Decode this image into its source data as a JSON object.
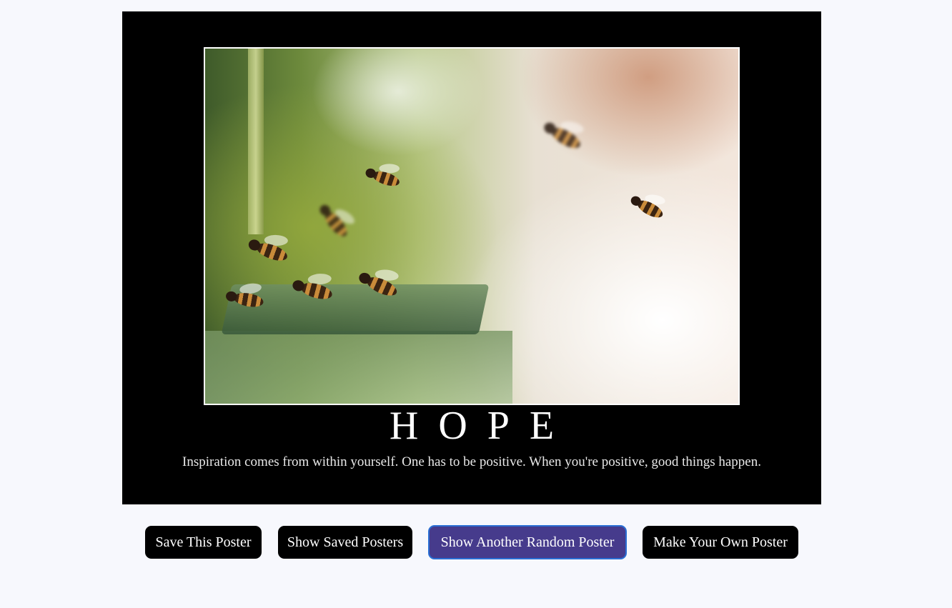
{
  "poster": {
    "image_alt": "bees flying near hive",
    "title": "HOPE",
    "quote": "Inspiration comes from within yourself. One has to be positive. When you're positive, good things happen."
  },
  "buttons": {
    "save": "Save This Poster",
    "show_saved": "Show Saved Posters",
    "random": "Show Another Random Poster",
    "make_own": "Make Your Own Poster"
  },
  "colors": {
    "page_background": "#f7f8fd",
    "poster_background": "#000000",
    "button_background": "#000000",
    "active_button_background": "#463b8c",
    "active_button_border": "#2a6fd4"
  }
}
